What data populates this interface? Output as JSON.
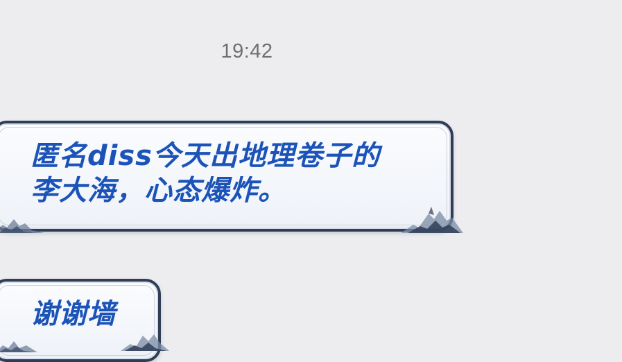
{
  "chat": {
    "timestamp": "19:42",
    "messages": [
      {
        "text": "匿名diss今天出地理卷子的\n李大海，心态爆炸。"
      },
      {
        "text": "谢谢墙"
      }
    ]
  },
  "colors": {
    "background": "#ededf0",
    "bubble_border": "#2f3e57",
    "message_text": "#1b53b8",
    "timestamp_text": "#6f6f73"
  },
  "icons": [
    "mountain-decoration-icon"
  ]
}
